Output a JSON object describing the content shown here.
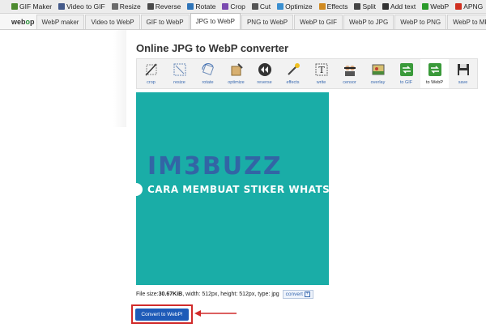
{
  "topnav": [
    {
      "label": "GIF Maker",
      "icon": "gif-maker-icon",
      "color": "#4c8a2e"
    },
    {
      "label": "Video to GIF",
      "icon": "video-icon",
      "color": "#445a8a"
    },
    {
      "label": "Resize",
      "icon": "resize-icon",
      "color": "#6a6a6a"
    },
    {
      "label": "Reverse",
      "icon": "reverse-icon",
      "color": "#4a4a4a"
    },
    {
      "label": "Rotate",
      "icon": "rotate-icon",
      "color": "#2e74b8"
    },
    {
      "label": "Crop",
      "icon": "crop-icon",
      "color": "#7a4ab0"
    },
    {
      "label": "Cut",
      "icon": "cut-icon",
      "color": "#555555"
    },
    {
      "label": "Optimize",
      "icon": "optimize-icon",
      "color": "#3a8fd0"
    },
    {
      "label": "Effects",
      "icon": "effects-icon",
      "color": "#d08a20"
    },
    {
      "label": "Split",
      "icon": "split-icon",
      "color": "#444444"
    },
    {
      "label": "Add text",
      "icon": "add-text-icon",
      "color": "#333333"
    },
    {
      "label": "WebP",
      "icon": "webp-icon",
      "color": "#2a9a2a"
    },
    {
      "label": "APNG",
      "icon": "apng-icon",
      "color": "#d03020"
    }
  ],
  "logo": {
    "prefix": "web",
    "middle": "o",
    "suffix": "p"
  },
  "tabs": [
    {
      "label": "WebP maker",
      "active": false
    },
    {
      "label": "Video to WebP",
      "active": false
    },
    {
      "label": "GIF to WebP",
      "active": false
    },
    {
      "label": "JPG to WebP",
      "active": true
    },
    {
      "label": "PNG to WebP",
      "active": false
    },
    {
      "label": "WebP to GIF",
      "active": false
    },
    {
      "label": "WebP to JPG",
      "active": false
    },
    {
      "label": "WebP to PNG",
      "active": false
    },
    {
      "label": "WebP to MP4",
      "active": false
    }
  ],
  "page_title": "Online JPG to WebP converter",
  "tools": [
    {
      "label": "crop",
      "icon": "crop-icon",
      "active": false
    },
    {
      "label": "resize",
      "icon": "resize-icon",
      "active": false
    },
    {
      "label": "rotate",
      "icon": "rotate-icon",
      "active": false
    },
    {
      "label": "optimize",
      "icon": "optimize-icon",
      "active": false
    },
    {
      "label": "reverse",
      "icon": "reverse-icon",
      "active": false
    },
    {
      "label": "effects",
      "icon": "effects-icon",
      "active": false
    },
    {
      "label": "write",
      "icon": "write-icon",
      "active": false
    },
    {
      "label": "censor",
      "icon": "censor-icon",
      "active": false
    },
    {
      "label": "overlay",
      "icon": "overlay-icon",
      "active": false
    },
    {
      "label": "to GIF",
      "icon": "to-gif-icon",
      "active": false
    },
    {
      "label": "to WebP",
      "icon": "to-webp-icon",
      "active": true
    },
    {
      "label": "save",
      "icon": "save-icon",
      "active": false
    }
  ],
  "image": {
    "watermark": "IM3BUZZ",
    "caption": "CARA MEMBUAT STIKER WHATSA",
    "bg_color": "#1aada7"
  },
  "fileinfo": {
    "prefix": "File size: ",
    "size": "30.67KiB",
    "details": ", width: 512px, height: 512px, type: jpg",
    "convert_label": "convert"
  },
  "convert_button": "Convert to WebP!",
  "colors": {
    "accent": "#1e5bb8",
    "highlight": "#d12b2b"
  }
}
